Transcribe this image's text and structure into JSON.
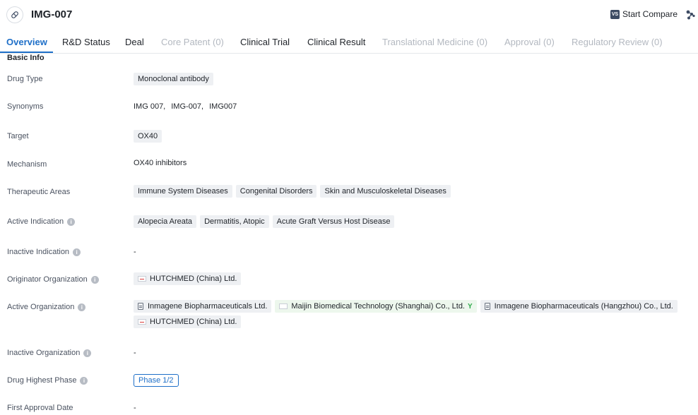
{
  "header": {
    "title": "IMG-007",
    "compare_badge": "VS",
    "compare_label": "Start Compare"
  },
  "tabs": [
    {
      "label": "Overview",
      "state": "active"
    },
    {
      "label": "R&D Status",
      "state": "enabled"
    },
    {
      "label": "Deal",
      "state": "enabled"
    },
    {
      "label": "Core Patent (0)",
      "state": "disabled"
    },
    {
      "label": "Clinical Trial",
      "state": "enabled"
    },
    {
      "label": "Clinical Result",
      "state": "enabled"
    },
    {
      "label": "Translational Medicine (0)",
      "state": "disabled"
    },
    {
      "label": "Approval (0)",
      "state": "disabled"
    },
    {
      "label": "Regulatory Review (0)",
      "state": "disabled"
    }
  ],
  "basic_info": {
    "section_title": "Basic Info",
    "drug_type": {
      "label": "Drug Type",
      "value": "Monoclonal antibody"
    },
    "synonyms": {
      "label": "Synonyms",
      "values": [
        "IMG 007,",
        "IMG-007,",
        "IMG007"
      ]
    },
    "target": {
      "label": "Target",
      "value": "OX40"
    },
    "mechanism": {
      "label": "Mechanism",
      "value": "OX40 inhibitors"
    },
    "therapeutic_areas": {
      "label": "Therapeutic Areas",
      "values": [
        "Immune System Diseases",
        "Congenital Disorders",
        "Skin and Musculoskeletal Diseases"
      ]
    },
    "active_indication": {
      "label": "Active Indication",
      "values": [
        "Alopecia Areata",
        "Dermatitis, Atopic",
        "Acute Graft Versus Host Disease"
      ]
    },
    "inactive_indication": {
      "label": "Inactive Indication",
      "value": "-"
    },
    "originator_organization": {
      "label": "Originator Organization",
      "values": [
        "HUTCHMED (China) Ltd."
      ]
    },
    "active_organization": {
      "label": "Active Organization",
      "values": [
        "Inmagene Biopharmaceuticals Ltd.",
        "Maijin Biomedical Technology (Shanghai) Co., Ltd.",
        "Inmagene Biopharmaceuticals (Hangzhou) Co., Ltd.",
        "HUTCHMED (China) Ltd."
      ]
    },
    "inactive_organization": {
      "label": "Inactive Organization",
      "value": "-"
    },
    "drug_highest_phase": {
      "label": "Drug Highest Phase",
      "value": "Phase 1/2"
    },
    "first_approval_date": {
      "label": "First Approval Date",
      "value": "-"
    }
  },
  "info_icon_glyph": "i",
  "colors": {
    "accent": "#1e6fc8",
    "disabled_tab": "#b3b8c0",
    "chip_bg": "#eef0f3"
  }
}
